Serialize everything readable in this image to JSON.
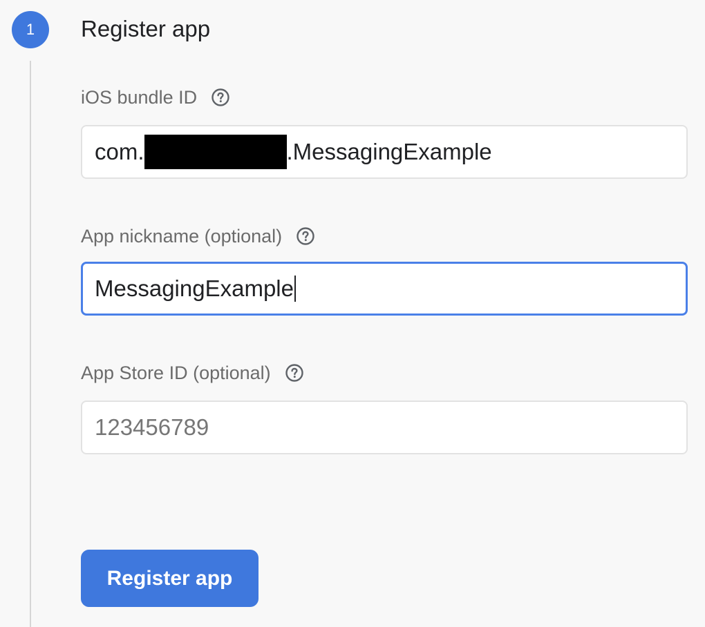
{
  "step": {
    "number": "1",
    "title": "Register app"
  },
  "fields": [
    {
      "label": "iOS bundle ID",
      "value_prefix": "com.",
      "value_suffix": ".MessagingExample",
      "redacted": true
    },
    {
      "label": "App nickname (optional)",
      "value": "MessagingExample",
      "focused": true
    },
    {
      "label": "App Store ID (optional)",
      "value": "",
      "placeholder": "123456789"
    }
  ],
  "register_button_label": "Register app",
  "colors": {
    "accent": "#3f78dd",
    "focus_border": "#4a80e8",
    "background": "#f8f8f8"
  }
}
